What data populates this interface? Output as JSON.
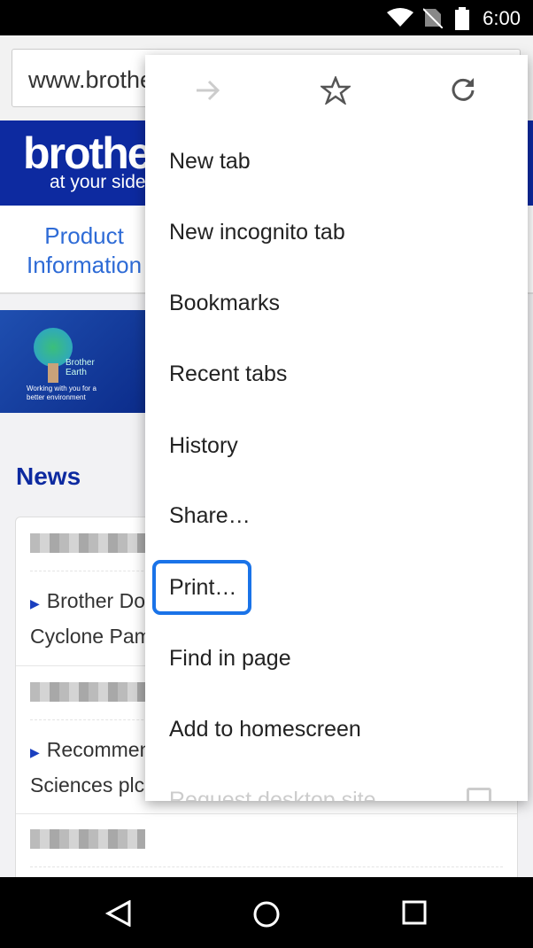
{
  "status_bar": {
    "time": "6:00",
    "icons": [
      "wifi-icon",
      "no-sim-icon",
      "battery-icon"
    ]
  },
  "browser": {
    "url": "www.brother"
  },
  "page": {
    "logo": "brother",
    "tagline": "at your side",
    "product_link": [
      "Product",
      "Information"
    ],
    "earth_banner": {
      "brand": [
        "Brother",
        "Earth"
      ],
      "text": [
        "Working with you for a",
        "better environment"
      ]
    },
    "news_heading": "News",
    "news_items": [
      {
        "line1": "Brother Do",
        "line2": "Cyclone Pam"
      },
      {
        "line1": "Recommen",
        "line2": "Sciences plc"
      }
    ]
  },
  "menu": {
    "top_icons": [
      "forward-icon",
      "bookmark-star-icon",
      "reload-icon"
    ],
    "items": [
      "New tab",
      "New incognito tab",
      "Bookmarks",
      "Recent tabs",
      "History",
      "Share…",
      "Print…",
      "Find in page",
      "Add to homescreen",
      "Request desktop site"
    ],
    "highlighted": "Print…",
    "accent": "#1a73e8"
  },
  "nav_bar": {
    "icons": [
      "back-icon",
      "home-icon",
      "recents-icon"
    ]
  }
}
